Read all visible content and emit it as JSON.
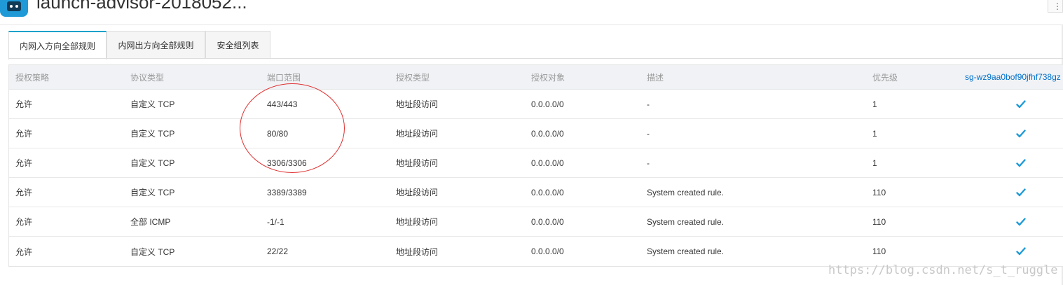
{
  "window": {
    "title": "launch-advisor-2018052..."
  },
  "tabs": [
    {
      "label": "内网入方向全部规则",
      "active": true
    },
    {
      "label": "内网出方向全部规则",
      "active": false
    },
    {
      "label": "安全组列表",
      "active": false
    }
  ],
  "table": {
    "headers": [
      "授权策略",
      "协议类型",
      "端口范围",
      "授权类型",
      "授权对象",
      "描述",
      "优先级",
      "sg-wz9aa0bof90jfhf738gz"
    ],
    "rows": [
      [
        "允许",
        "自定义 TCP",
        "443/443",
        "地址段访问",
        "0.0.0.0/0",
        "-",
        "1"
      ],
      [
        "允许",
        "自定义 TCP",
        "80/80",
        "地址段访问",
        "0.0.0.0/0",
        "-",
        "1"
      ],
      [
        "允许",
        "自定义 TCP",
        "3306/3306",
        "地址段访问",
        "0.0.0.0/0",
        "-",
        "1"
      ],
      [
        "允许",
        "自定义 TCP",
        "3389/3389",
        "地址段访问",
        "0.0.0.0/0",
        "System created rule.",
        "110"
      ],
      [
        "允许",
        "全部 ICMP",
        "-1/-1",
        "地址段访问",
        "0.0.0.0/0",
        "System created rule.",
        "110"
      ],
      [
        "允许",
        "自定义 TCP",
        "22/22",
        "地址段访问",
        "0.0.0.0/0",
        "System created rule.",
        "110"
      ]
    ]
  },
  "icons": {
    "app": "app-icon",
    "check": "check-icon",
    "corner": "more-icon"
  },
  "colors": {
    "accent": "#00a2ca",
    "link": "#0070cc",
    "check": "#1f9ad6",
    "annotation": "#e03030"
  },
  "watermark": "https://blog.csdn.net/s_t_ruggle"
}
